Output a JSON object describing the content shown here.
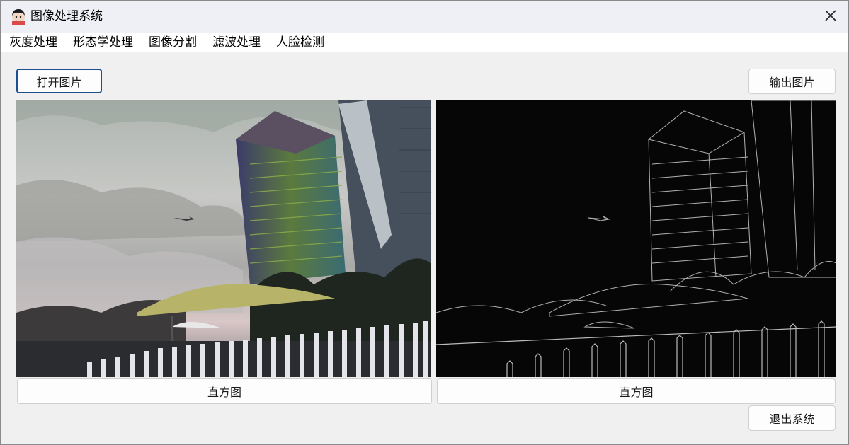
{
  "window": {
    "title": "图像处理系统",
    "icon": "avatar-icon",
    "close_icon": "close-icon"
  },
  "menu": [
    {
      "label": "灰度处理"
    },
    {
      "label": "形态学处理"
    },
    {
      "label": "图像分割"
    },
    {
      "label": "滤波处理"
    },
    {
      "label": "人脸检测"
    }
  ],
  "toolbar": {
    "open_label": "打开图片",
    "export_label": "输出图片"
  },
  "panels": {
    "left_image": "original-photo-city-buildings",
    "right_image": "edge-detected-photo",
    "left_histogram_label": "直方图",
    "right_histogram_label": "直方图"
  },
  "footer": {
    "exit_label": "退出系统"
  },
  "colors": {
    "focus_border": "#1f4f93",
    "titlebar_bg": "#eef0f6",
    "window_bg": "#f0f0f0"
  }
}
